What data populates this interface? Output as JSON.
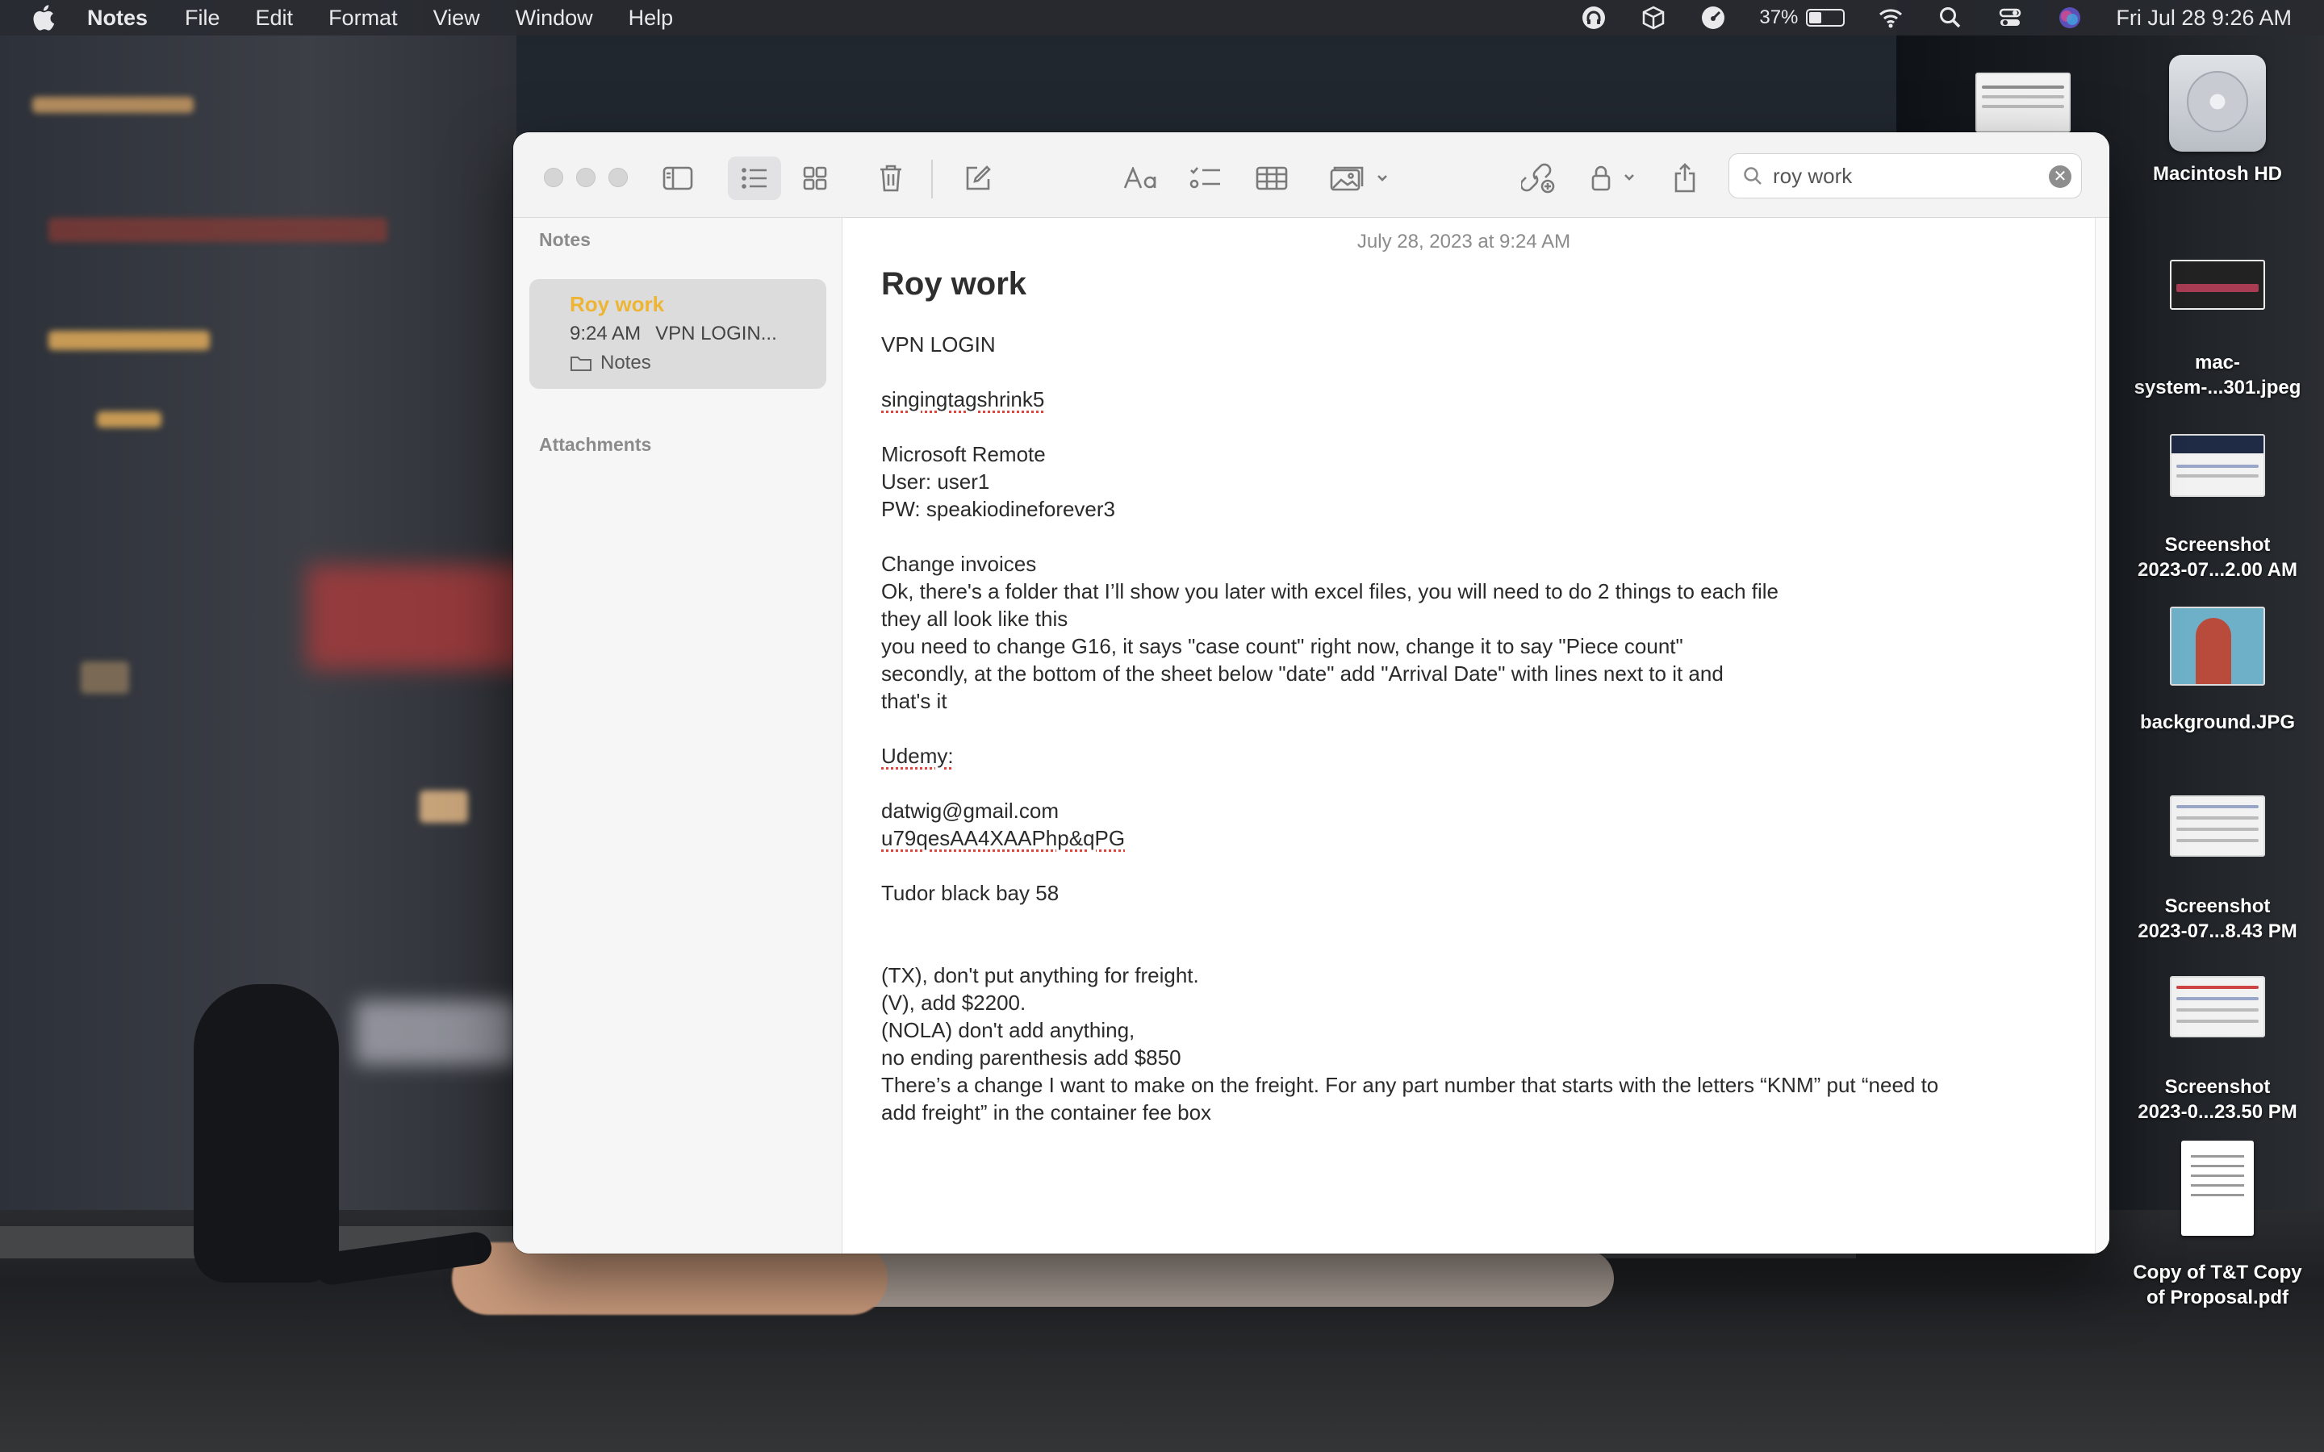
{
  "menubar": {
    "app_name": "Notes",
    "items": [
      "File",
      "Edit",
      "Format",
      "View",
      "Window",
      "Help"
    ],
    "battery_percent": "37%",
    "battery_level": 0.37,
    "clock": "Fri Jul 28  9:26 AM",
    "status_icons": [
      "headphones-icon",
      "box-icon",
      "gauge-icon",
      "battery-icon",
      "wifi-icon",
      "spotlight-search-icon",
      "control-center-icon",
      "siri-icon"
    ]
  },
  "desktop": {
    "items": [
      {
        "label": "Macintosh HD",
        "icon": "hard-drive-icon"
      },
      {
        "label": "mac-system-...301.jpeg",
        "label_lines": [
          "mac-",
          "system-...301.jpeg"
        ],
        "icon": "image-file-icon"
      },
      {
        "label_lines": [
          "Screenshot",
          "2023-07...2.00 AM"
        ],
        "icon": "screenshot-file-icon"
      },
      {
        "label_lines": [
          "background.JPG"
        ],
        "icon": "image-file-icon"
      },
      {
        "label_lines": [
          "Screenshot",
          "2023-07...8.43 PM"
        ],
        "icon": "screenshot-file-icon"
      },
      {
        "label_lines": [
          "Screenshot",
          "2023-0...23.50 PM"
        ],
        "icon": "screenshot-file-icon"
      },
      {
        "label_lines": [
          "Copy of T&T Copy",
          "of Proposal.pdf"
        ],
        "icon": "pdf-file-icon"
      }
    ]
  },
  "window": {
    "search": {
      "value": "roy work",
      "placeholder": "Search"
    },
    "sidebar": {
      "notes_section": "Notes",
      "attachments_section": "Attachments",
      "selected_note": {
        "title": "Roy work",
        "time": "9:24 AM",
        "preview": "VPN LOGIN...",
        "folder": "Notes"
      }
    },
    "editor": {
      "date": "July 28, 2023 at 9:24 AM",
      "title": "Roy work",
      "lines": [
        "VPN LOGIN",
        "",
        "singingtagshrink5",
        "",
        "Microsoft Remote",
        "User: user1",
        "PW: speakiodineforever3",
        "",
        "Change invoices",
        "Ok, there's a folder that I’ll show you later with excel files, you will need to do 2 things to each file",
        "they all look like this",
        "you need to change G16, it says \"case count\" right now, change it to say \"Piece count\"",
        "secondly, at the bottom of the sheet below \"date\" add \"Arrival Date\" with lines next to it and",
        "that's it",
        "",
        "Udemy:",
        "",
        "datwig@gmail.com",
        "u79qesAA4XAAPhp&qPG",
        "",
        "Tudor black bay 58",
        "",
        "",
        "(TX), don't put anything for freight.",
        "(V), add $2200.",
        "(NOLA) don't add anything,",
        "no ending parenthesis add $850",
        "There’s a change I want to make on the freight. For any part number that starts with the letters “KNM” put “need to",
        "add freight” in the container fee box"
      ]
    }
  }
}
